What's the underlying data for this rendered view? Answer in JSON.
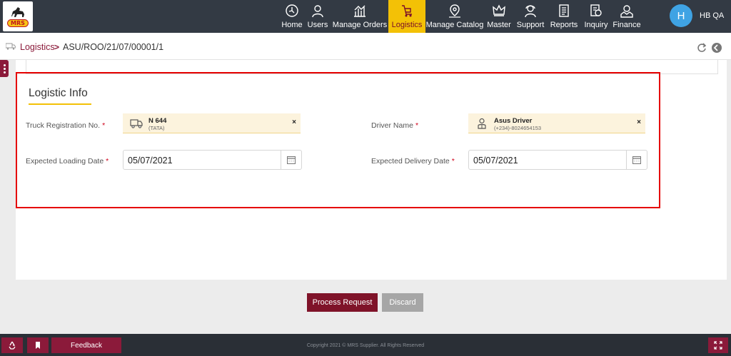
{
  "logo": {
    "text": "MRS"
  },
  "nav": {
    "items": [
      {
        "label": "Home",
        "icon": "home-icon"
      },
      {
        "label": "Users",
        "icon": "users-icon"
      },
      {
        "label": "Manage Orders",
        "icon": "chart-icon"
      },
      {
        "label": "Logistics",
        "icon": "logistics-icon",
        "active": true
      },
      {
        "label": "Manage Catalog",
        "icon": "map-pin-icon"
      },
      {
        "label": "Master",
        "icon": "crown-icon"
      },
      {
        "label": "Support",
        "icon": "support-icon"
      },
      {
        "label": "Reports",
        "icon": "reports-icon"
      },
      {
        "label": "Inquiry",
        "icon": "inquiry-icon"
      },
      {
        "label": "Finance",
        "icon": "finance-icon"
      }
    ]
  },
  "user": {
    "initial": "H",
    "name": "HB QA"
  },
  "breadcrumb": {
    "link": "Logistics",
    "separator": ">",
    "current": "ASU/ROO/21/07/00001/1"
  },
  "section": {
    "title": "Logistic Info"
  },
  "form": {
    "truck_label": "Truck Registration No.",
    "truck_value": "N 644",
    "truck_sub": "(TATA)",
    "driver_label": "Driver Name",
    "driver_value": "Asus Driver",
    "driver_sub": "(+234)-8024654153",
    "loading_label": "Expected Loading Date",
    "loading_value": "05/07/2021",
    "delivery_label": "Expected Delivery Date",
    "delivery_value": "05/07/2021",
    "required_mark": "*",
    "clear_mark": "×"
  },
  "actions": {
    "process_label": "Process Request",
    "discard_label": "Discard"
  },
  "footer": {
    "feedback_label": "Feedback",
    "copyright": "Copyright 2021 © MRS Supplier. All Rights Reserved"
  },
  "colors": {
    "brand": "#7f1329",
    "accent": "#f3c106",
    "nav_bg": "#333a44",
    "highlight": "#e50000"
  }
}
